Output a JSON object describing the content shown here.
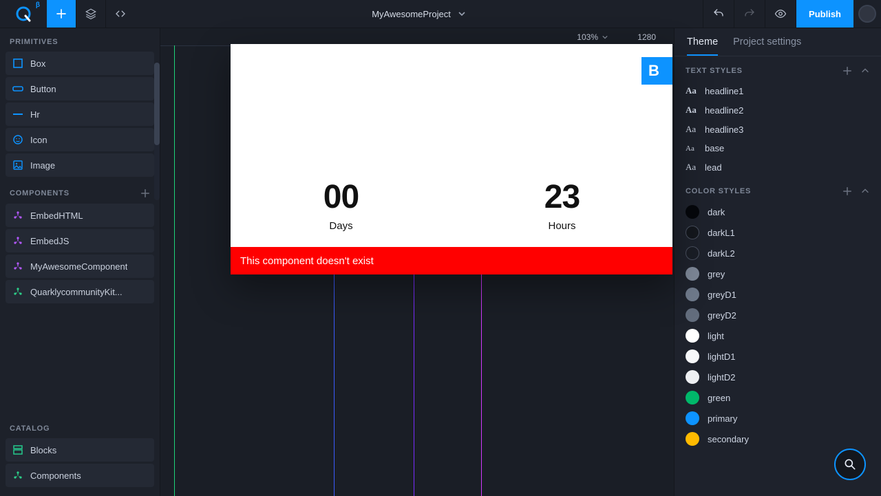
{
  "header": {
    "logo_beta": "β",
    "project_name": "MyAwesomeProject",
    "publish_label": "Publish"
  },
  "left": {
    "primitives_title": "PRIMITIVES",
    "primitives": [
      "Box",
      "Button",
      "Hr",
      "Icon",
      "Image"
    ],
    "components_title": "COMPONENTS",
    "components": [
      "EmbedHTML",
      "EmbedJS",
      "MyAwesomeComponent",
      "QuarklycommunityKit..."
    ],
    "catalog_title": "CATALOG",
    "catalog": [
      "Blocks",
      "Components"
    ]
  },
  "canvas": {
    "zoom": "103%",
    "width_label": "1280",
    "countdown": [
      {
        "value": "00",
        "label": "Days"
      },
      {
        "value": "23",
        "label": "Hours"
      }
    ],
    "blue_button_glyph": "B",
    "error_text": "This component doesn't exist"
  },
  "right": {
    "tab_theme": "Theme",
    "tab_settings": "Project settings",
    "text_styles_title": "TEXT STYLES",
    "text_styles": [
      "headline1",
      "headline2",
      "headline3",
      "base",
      "lead"
    ],
    "color_styles_title": "COLOR STYLES",
    "colors": [
      {
        "name": "dark",
        "hex": "#05070b"
      },
      {
        "name": "darkL1",
        "hex": "#14171d"
      },
      {
        "name": "darkL2",
        "hex": "#1a1e26"
      },
      {
        "name": "grey",
        "hex": "#7d8797"
      },
      {
        "name": "greyD1",
        "hex": "#6f7a8b"
      },
      {
        "name": "greyD2",
        "hex": "#636d7d"
      },
      {
        "name": "light",
        "hex": "#ffffff"
      },
      {
        "name": "lightD1",
        "hex": "#f7f8fa"
      },
      {
        "name": "lightD2",
        "hex": "#eef0f3"
      },
      {
        "name": "green",
        "hex": "#00b86a"
      },
      {
        "name": "primary",
        "hex": "#0d93ff"
      },
      {
        "name": "secondary",
        "hex": "#ffba00"
      }
    ]
  }
}
